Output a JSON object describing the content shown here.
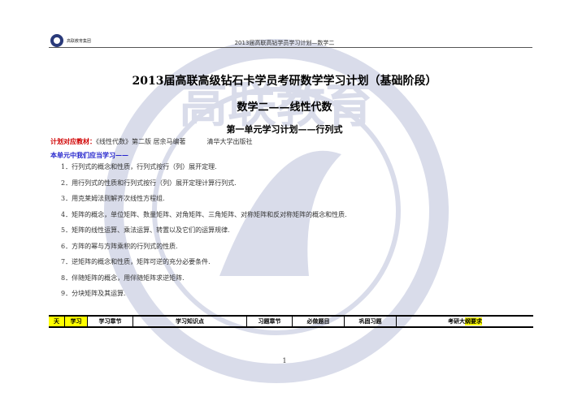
{
  "header": {
    "running_title": "2013届高联高钻学员学习计划—数学二",
    "logo_text": "高联教育集团"
  },
  "titles": {
    "main": "2013届高联高级钻石卡学员考研数学学习计划（基础阶段）",
    "subject": "数学二——线性代数",
    "unit": "第一单元学习计划——行列式"
  },
  "textbook": {
    "label": "计划对应教材：",
    "book": "《线性代数》第二版   居余马编著",
    "publisher": "清华大学出版社"
  },
  "learn_heading": "本单元中我们应当学习——",
  "items": [
    "1．行列式的概念和性质，行列式按行（列）展开定理.",
    "2．用行列式的性质和行列式按行（列）展开定理计算行列式.",
    "3．用克莱姆法则解齐次线性方程组.",
    "4．矩阵的概念，单位矩阵、数量矩阵、对角矩阵、三角矩阵、对称矩阵和反对称矩阵的概念和性质.",
    "5．矩阵的线性运算、乘法运算、转置以及它们的运算规律.",
    "6．方阵的幂与方阵乘积的行列式的性质.",
    "7．逆矩阵的概念和性质，矩阵可逆的充分必要条件.",
    "8．伴随矩阵的概念，用伴随矩阵求逆矩阵.",
    "9．分块矩阵及其运算."
  ],
  "table_header": {
    "day": "天",
    "study": "学习",
    "chapter": "学习章节",
    "knowledge": "学习知识点",
    "exercise_chapter": "习题章节",
    "must_do": "必做题目",
    "consolidation": "巩固习题",
    "outline_prefix": "考研大",
    "outline_highlight": "纲要求"
  },
  "page_number": "1",
  "watermark_text": "高联教育集团 GAOLIAN EDUCATION"
}
